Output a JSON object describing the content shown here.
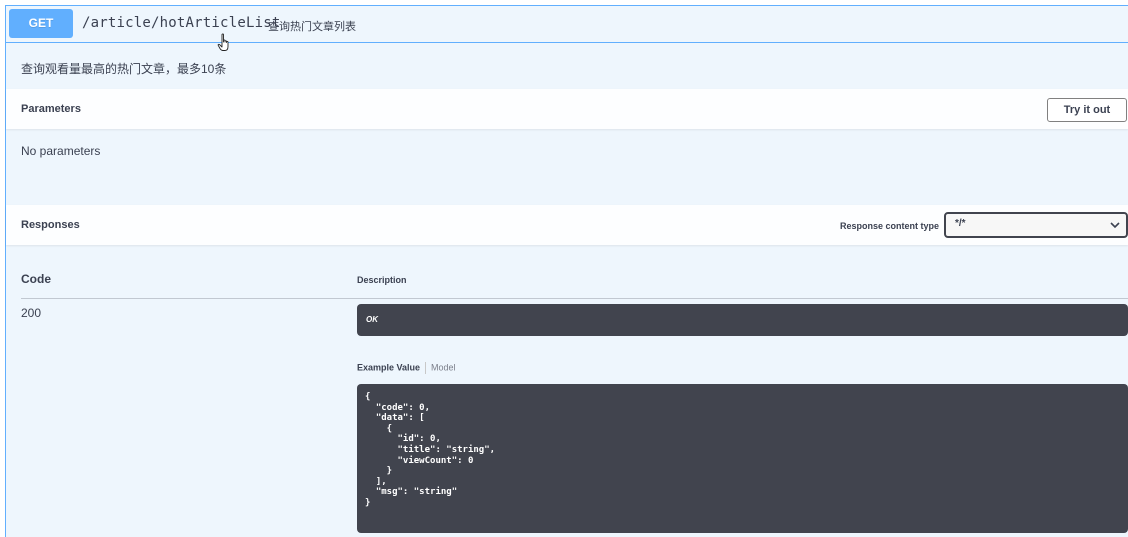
{
  "operation": {
    "method": "GET",
    "path": "/article/hotArticleList",
    "summary": "查询热门文章列表",
    "description": "查询观看量最高的热门文章，最多10条"
  },
  "parameters": {
    "title": "Parameters",
    "try_label": "Try it out",
    "empty_text": "No parameters"
  },
  "responses": {
    "title": "Responses",
    "content_type_label": "Response content type",
    "content_type_value": "*/*",
    "col_code": "Code",
    "col_description": "Description",
    "rows": [
      {
        "code": "200",
        "description": "OK",
        "tab_example": "Example Value",
        "tab_model": "Model",
        "example": "{\n  \"code\": 0,\n  \"data\": [\n    {\n      \"id\": 0,\n      \"title\": \"string\",\n      \"viewCount\": 0\n    }\n  ],\n  \"msg\": \"string\"\n}"
      }
    ]
  },
  "colors": {
    "get_accent": "#61affe",
    "block_bg": "#eef6fd",
    "code_bg": "#41444e"
  },
  "icons": {
    "cursor": "hand-pointer-icon",
    "select": "chevron-down-icon"
  }
}
